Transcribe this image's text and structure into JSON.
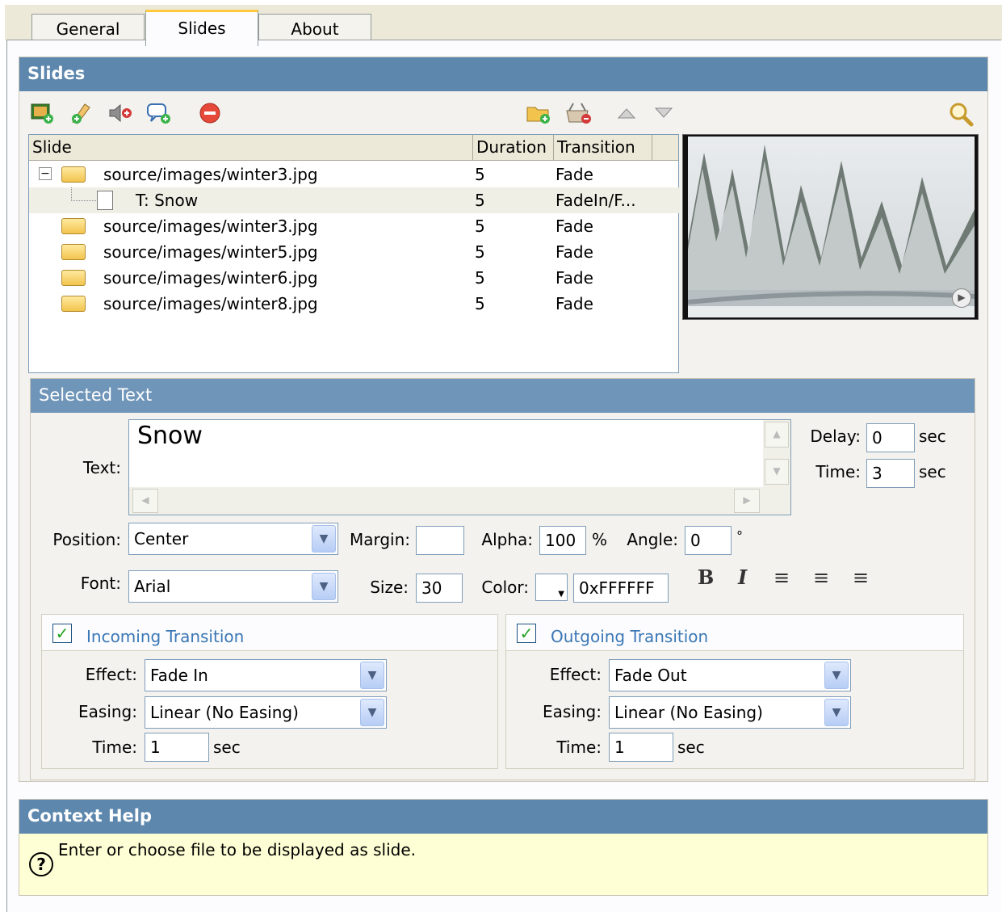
{
  "tabs": [
    {
      "label": "General"
    },
    {
      "label": "Slides"
    },
    {
      "label": "About"
    }
  ],
  "slides_panel": {
    "title": "Slides",
    "columns": {
      "slide": "Slide",
      "duration": "Duration",
      "transition": "Transition"
    },
    "rows": [
      {
        "name": "source/images/winter3.jpg",
        "duration": "5",
        "transition": "Fade",
        "expander": "⊟"
      },
      {
        "name": "T: Snow",
        "duration": "5",
        "transition": "FadeIn/F..."
      },
      {
        "name": "source/images/winter3.jpg",
        "duration": "5",
        "transition": "Fade"
      },
      {
        "name": "source/images/winter5.jpg",
        "duration": "5",
        "transition": "Fade"
      },
      {
        "name": "source/images/winter6.jpg",
        "duration": "5",
        "transition": "Fade"
      },
      {
        "name": "source/images/winter8.jpg",
        "duration": "5",
        "transition": "Fade"
      }
    ]
  },
  "selected_text": {
    "title": "Selected Text",
    "text_label": "Text:",
    "text_value": "Snow",
    "delay_label": "Delay:",
    "delay_value": "0",
    "time_label": "Time:",
    "time_value": "3",
    "sec": "sec",
    "position_label": "Position:",
    "position_value": "Center",
    "margin_label": "Margin:",
    "margin_value": "",
    "alpha_label": "Alpha:",
    "alpha_value": "100",
    "percent": "%",
    "angle_label": "Angle:",
    "angle_value": "0",
    "degree": "°",
    "font_label": "Font:",
    "font_value": "Arial",
    "size_label": "Size:",
    "size_value": "30",
    "color_label": "Color:",
    "color_value": "0xFFFFFF",
    "bold": "B",
    "italic": "I",
    "align_left": "≡",
    "align_center": "≡",
    "align_right": "≡"
  },
  "incoming": {
    "legend": "Incoming Transition",
    "effect_label": "Effect:",
    "effect_value": "Fade In",
    "easing_label": "Easing:",
    "easing_value": "Linear (No Easing)",
    "time_label": "Time:",
    "time_value": "1",
    "sec": "sec"
  },
  "outgoing": {
    "legend": "Outgoing Transition",
    "effect_label": "Effect:",
    "effect_value": "Fade Out",
    "easing_label": "Easing:",
    "easing_value": "Linear (No Easing)",
    "time_label": "Time:",
    "time_value": "1",
    "sec": "sec"
  },
  "context_help": {
    "title": "Context Help",
    "icon": "?",
    "message": "Enter or choose file to be displayed as slide."
  },
  "icons": {
    "add_image": "add-image-icon",
    "add_text": "add-text-icon",
    "add_sound": "add-sound-icon",
    "add_comment": "add-comment-icon",
    "remove": "remove-icon",
    "add_folder": "add-folder-icon",
    "basket": "basket-icon",
    "move_up": "up-arrow-icon",
    "move_down": "down-arrow-icon",
    "zoom": "magnifier-icon"
  },
  "colors": {
    "header_blue": "#5d87ad",
    "help_bg": "#ffffd5",
    "selected_row": "#f0efe6"
  }
}
